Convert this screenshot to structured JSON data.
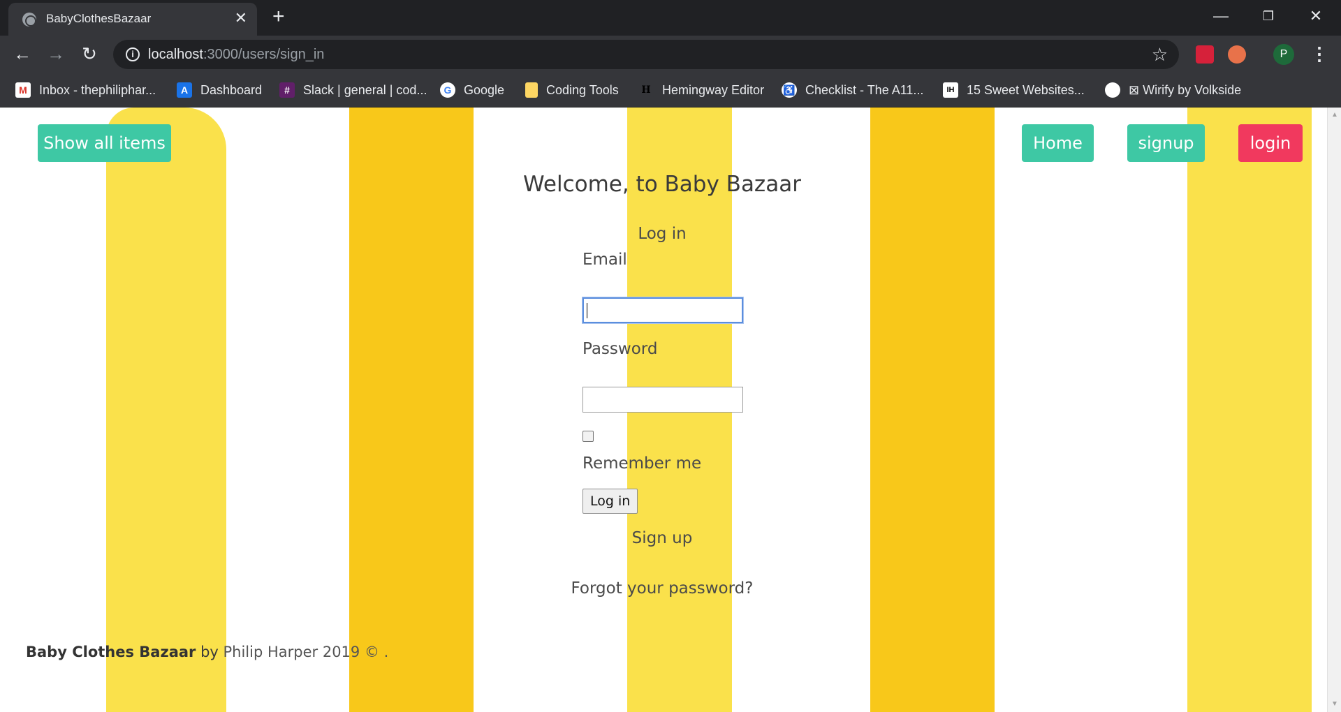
{
  "browser": {
    "tab_title": "BabyClothesBazaar",
    "url_host": "localhost",
    "url_path": ":3000/users/sign_in",
    "profile_initial": "P",
    "bookmarks": [
      {
        "label": "Inbox - thephiliphar...",
        "icon": "gmail-icon",
        "color": "#d93025"
      },
      {
        "label": "Dashboard",
        "icon": "dashboard-icon",
        "color": "#1a73e8"
      },
      {
        "label": "Slack | general | cod...",
        "icon": "slack-icon",
        "color": "#611f69"
      },
      {
        "label": "Google",
        "icon": "google-icon",
        "color": "#ffffff"
      },
      {
        "label": "Coding Tools",
        "icon": "folder-icon",
        "color": "#fdd663"
      },
      {
        "label": "Hemingway Editor",
        "icon": "hemingway-icon",
        "color": "#000000"
      },
      {
        "label": "Checklist - The A11...",
        "icon": "accessibility-icon",
        "color": "#ffffff"
      },
      {
        "label": "15 Sweet Websites...",
        "icon": "ih-icon",
        "color": "#ffffff"
      },
      {
        "label": "⊠ Wirify by Volkside",
        "icon": "globe-icon",
        "color": "#ffffff"
      }
    ]
  },
  "nav": {
    "show_all": "Show all items",
    "home": "Home",
    "signup": "signup",
    "login": "login"
  },
  "main": {
    "welcome": "Welcome, to Baby Bazaar",
    "form_title": "Log in",
    "email_label": "Email",
    "password_label": "Password",
    "remember_label": "Remember me",
    "submit_label": "Log in",
    "signup_link": "Sign up",
    "forgot_link": "Forgot your password?"
  },
  "footer": {
    "brand": "Baby Clothes Bazaar",
    "by": " by ",
    "author": "Philip Harper 2019 © ."
  },
  "colors": {
    "teal": "#3ec8a4",
    "red": "#f1395e",
    "stripe_light": "#fae14b",
    "stripe_dark": "#f8c81a"
  }
}
